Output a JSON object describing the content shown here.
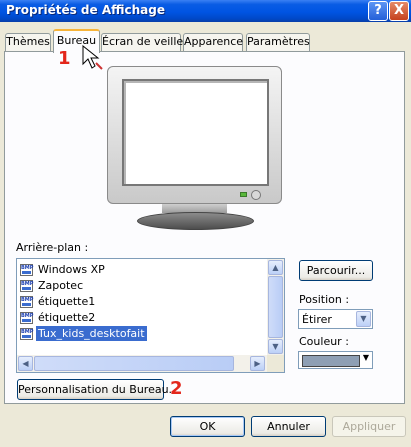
{
  "window": {
    "title": "Propriétés de Affichage",
    "help_glyph": "?",
    "close_glyph": "X"
  },
  "tabs": [
    {
      "label": "Thèmes",
      "active": false
    },
    {
      "label": "Bureau",
      "active": true
    },
    {
      "label": "Écran de veille",
      "active": false
    },
    {
      "label": "Apparence",
      "active": false
    },
    {
      "label": "Paramètres",
      "active": false
    }
  ],
  "background": {
    "label": "Arrière-plan :",
    "items": [
      {
        "name": "Windows XP",
        "icon": "bmp-file-icon",
        "selected": false
      },
      {
        "name": "Zapotec",
        "icon": "bmp-file-icon",
        "selected": false
      },
      {
        "name": "étiquette1",
        "icon": "bmp-file-icon",
        "selected": false
      },
      {
        "name": "étiquette2",
        "icon": "bmp-file-icon",
        "selected": false
      },
      {
        "name": "Tux_kids_desktofait",
        "icon": "bmp-file-icon",
        "selected": true
      }
    ],
    "file_icon_text": "BMP"
  },
  "browse_button": "Parcourir...",
  "position": {
    "label": "Position :",
    "value": "Étirer"
  },
  "color": {
    "label": "Couleur :",
    "swatch": "#8e9fb4"
  },
  "customize_button": "Personnalisation du Bureau...",
  "annotations": {
    "marker1": "1",
    "marker2": "2"
  },
  "footer": {
    "ok": "OK",
    "cancel": "Annuler",
    "apply": "Appliquer"
  },
  "colors": {
    "title_bar": "#0054e3",
    "selection": "#3a6ccf",
    "annotation": "#e3261b",
    "active_tab_accent": "#f7b43a"
  }
}
